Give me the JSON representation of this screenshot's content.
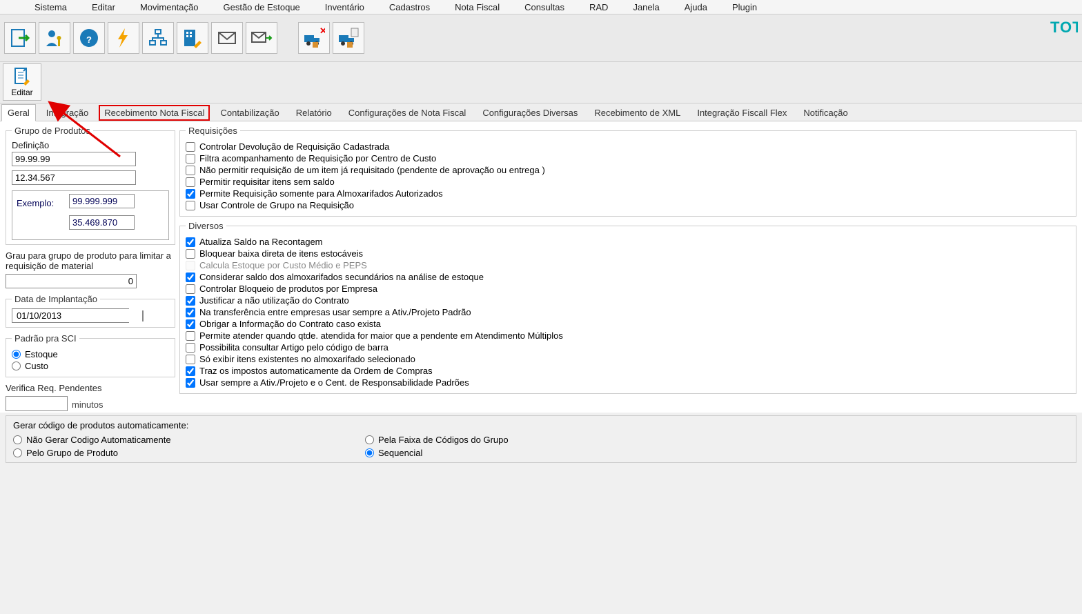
{
  "menubar": [
    "Sistema",
    "Editar",
    "Movimentação",
    "Gestão de Estoque",
    "Inventário",
    "Cadastros",
    "Nota Fiscal",
    "Consultas",
    "RAD",
    "Janela",
    "Ajuda",
    "Plugin"
  ],
  "brand": "TOTVS",
  "ribbon": {
    "editar": "Editar"
  },
  "tabs": {
    "items": [
      {
        "label": "Geral",
        "active": true
      },
      {
        "label": "Integração"
      },
      {
        "label": "Recebimento Nota Fiscal",
        "highlight": true
      },
      {
        "label": "Contabilização"
      },
      {
        "label": "Relatório"
      },
      {
        "label": "Configurações de Nota Fiscal"
      },
      {
        "label": "Configurações Diversas"
      },
      {
        "label": "Recebimento de XML"
      },
      {
        "label": "Integração Fiscall Flex"
      },
      {
        "label": "Notificação"
      }
    ]
  },
  "left": {
    "grupoProdutos": {
      "legend": "Grupo de Produtos",
      "definicao_label": "Definição",
      "def1": "99.99.99",
      "def2": "12.34.567",
      "exemplo_label": "Exemplo:",
      "ex1": "99.999.999",
      "ex2": "35.469.870"
    },
    "grau_label": "Grau para grupo de produto para limitar a requisição de material",
    "grau_value": "0",
    "implantacao": {
      "legend": "Data de Implantação",
      "value": "01/10/2013"
    },
    "padraoSci": {
      "legend": "Padrão pra SCI",
      "opt1": "Estoque",
      "opt2": "Custo",
      "selected": "Estoque"
    },
    "verificaReq": {
      "label": "Verifica Req. Pendentes",
      "unit": "minutos",
      "value": ""
    }
  },
  "right": {
    "requisicoes": {
      "legend": "Requisições",
      "items": [
        {
          "label": "Controlar Devolução de Requisição Cadastrada",
          "checked": false
        },
        {
          "label": "Filtra acompanhamento de Requisição por Centro de Custo",
          "checked": false
        },
        {
          "label": "Não permitir requisição de um item já requisitado (pendente de aprovação ou entrega )",
          "checked": false
        },
        {
          "label": "Permitir requisitar itens sem saldo",
          "checked": false
        },
        {
          "label": "Permite Requisição somente para Almoxarifados Autorizados",
          "checked": true
        },
        {
          "label": "Usar Controle de Grupo na Requisição",
          "checked": false
        }
      ]
    },
    "diversos": {
      "legend": "Diversos",
      "items": [
        {
          "label": "Atualiza Saldo na Recontagem",
          "checked": true
        },
        {
          "label": "Bloquear baixa direta de itens estocáveis",
          "checked": false
        },
        {
          "label": "Calcula Estoque por Custo Médio e PEPS",
          "checked": false,
          "disabled": true
        },
        {
          "label": "Considerar saldo dos almoxarifados secundários na análise de estoque",
          "checked": true
        },
        {
          "label": "Controlar Bloqueio de produtos por Empresa",
          "checked": false
        },
        {
          "label": "Justificar a não utilização do Contrato",
          "checked": true
        },
        {
          "label": "Na transferência entre empresas usar sempre a Ativ./Projeto Padrão",
          "checked": true
        },
        {
          "label": "Obrigar a Informação do Contrato caso exista",
          "checked": true
        },
        {
          "label": "Permite atender quando qtde. atendida for maior que a pendente em Atendimento Múltiplos",
          "checked": false
        },
        {
          "label": "Possibilita consultar Artigo pelo código de barra",
          "checked": false
        },
        {
          "label": "Só exibir itens existentes no almoxarifado selecionado",
          "checked": false
        },
        {
          "label": "Traz os impostos automaticamente da Ordem de Compras",
          "checked": true
        },
        {
          "label": "Usar sempre a Ativ./Projeto e o Cent. de Responsabilidade Padrões",
          "checked": true
        }
      ]
    }
  },
  "bottom": {
    "title": "Gerar código de produtos automaticamente:",
    "options": [
      {
        "label": "Não Gerar Codigo Automaticamente",
        "checked": false
      },
      {
        "label": "Pela Faixa de Códigos do Grupo",
        "checked": false
      },
      {
        "label": "Pelo Grupo de Produto",
        "checked": false
      },
      {
        "label": "Sequencial",
        "checked": true
      }
    ]
  }
}
